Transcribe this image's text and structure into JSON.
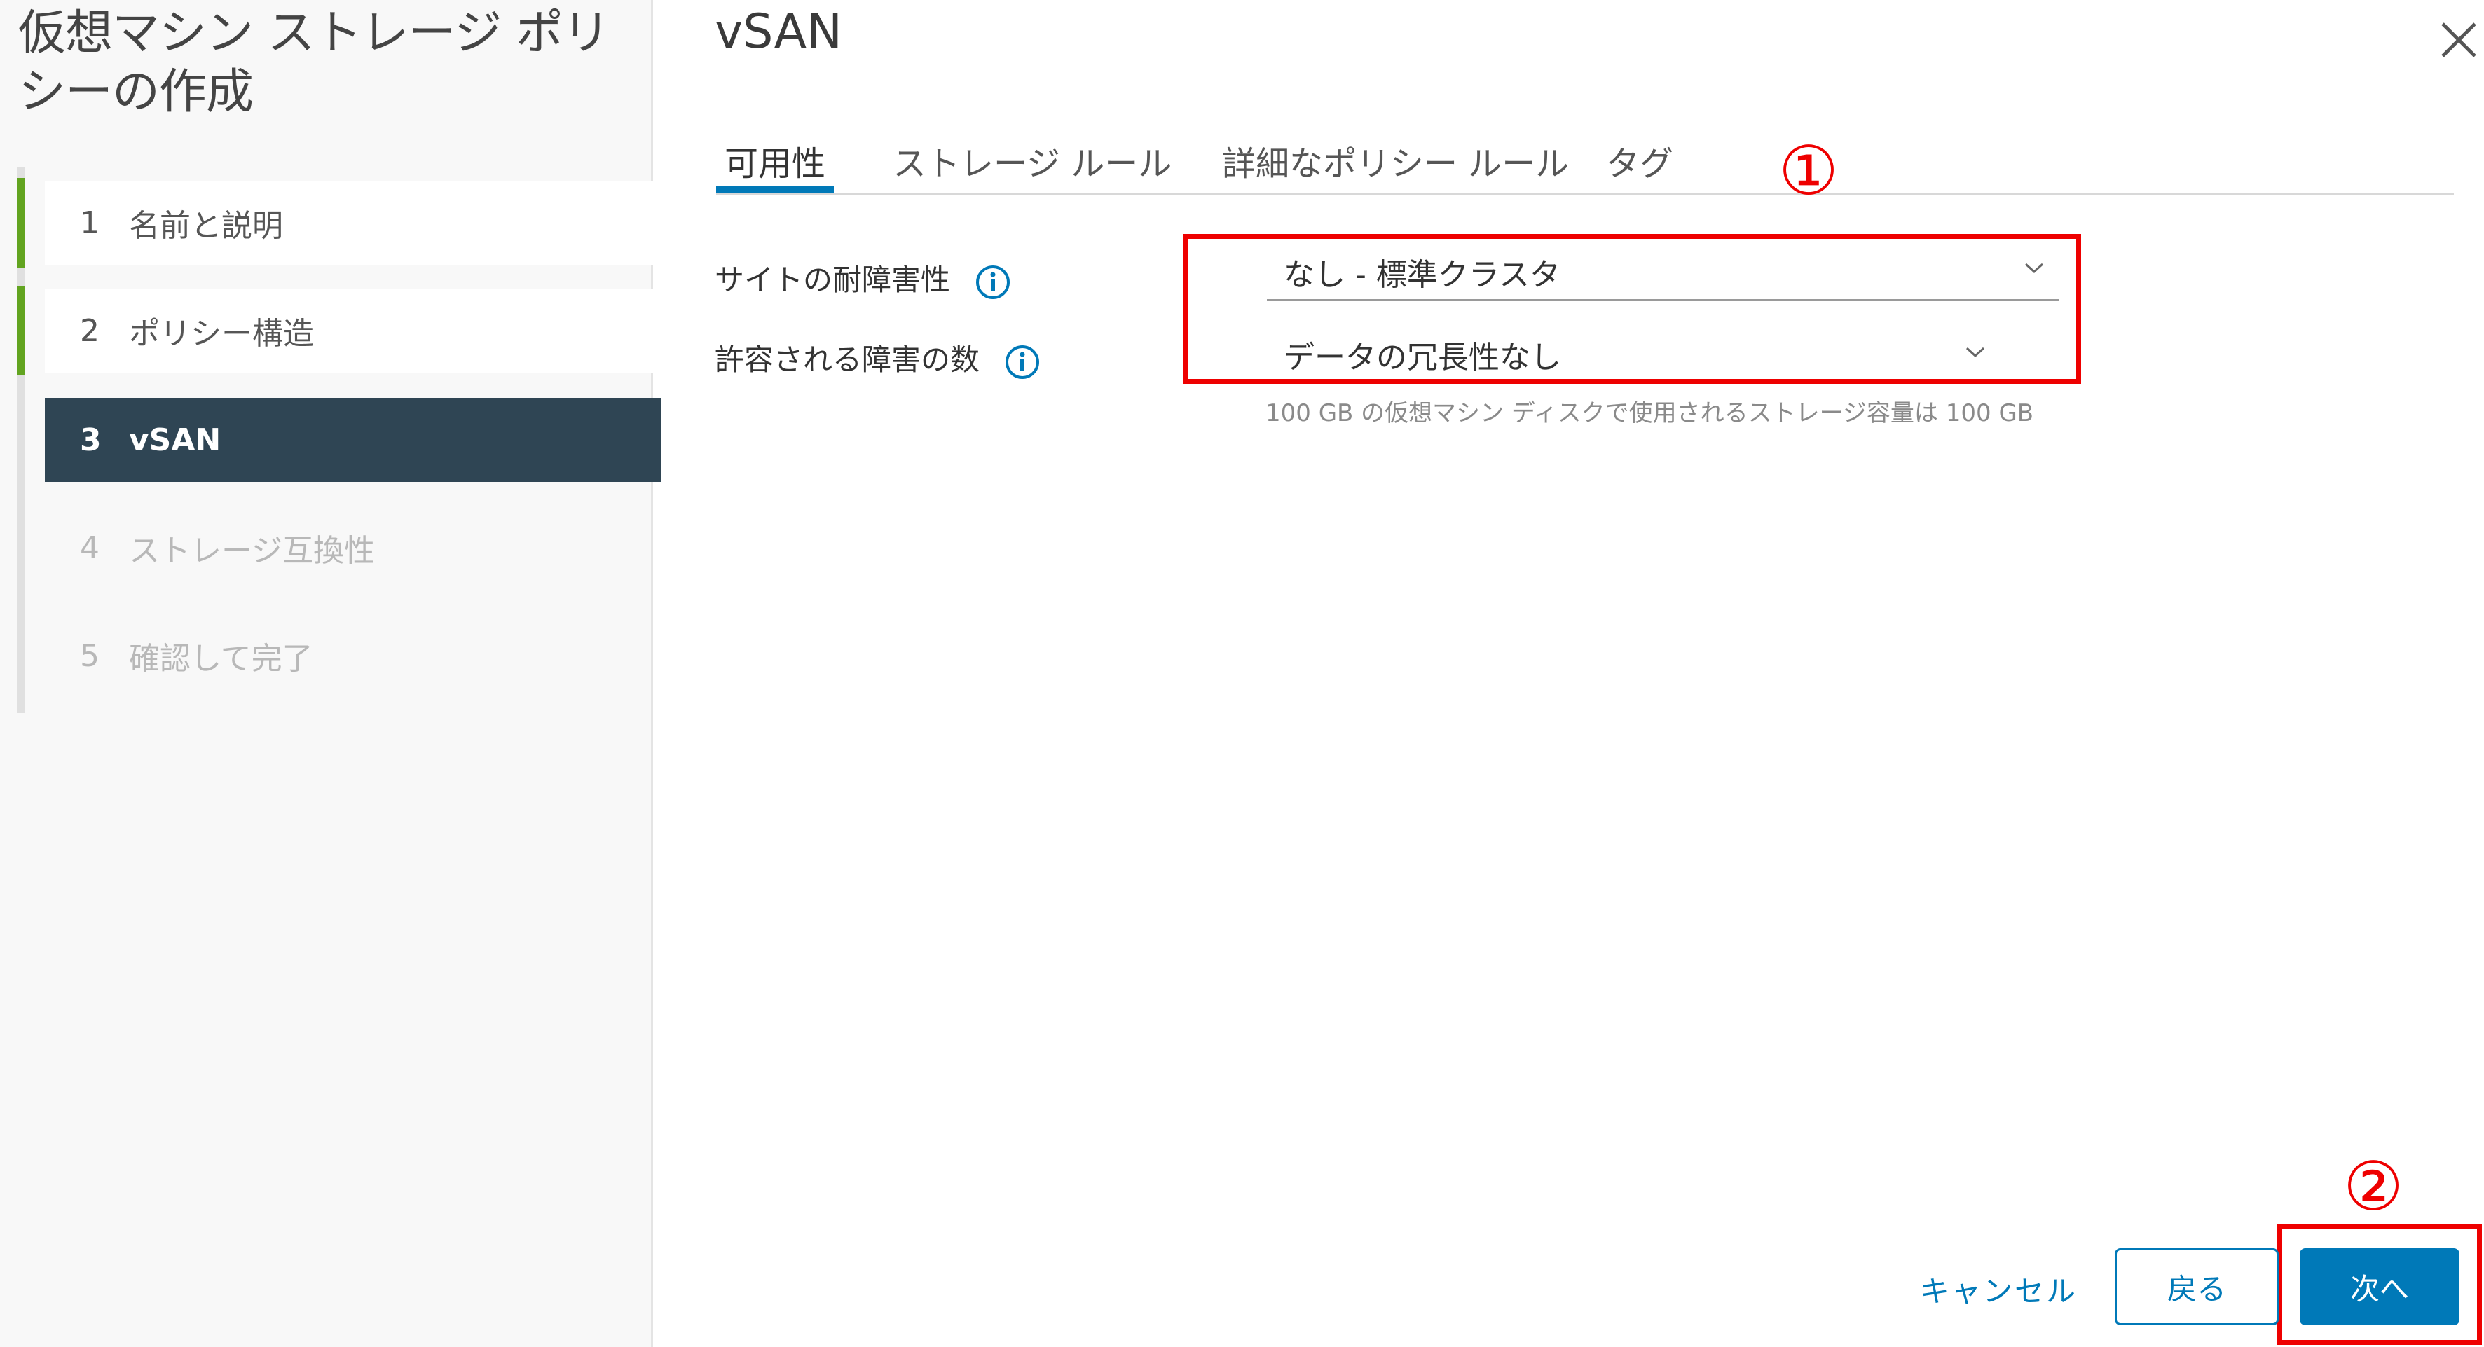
{
  "wizard": {
    "title": "仮想マシン ストレージ ポリシーの作成",
    "steps": [
      {
        "num": "1",
        "label": "名前と説明",
        "state": "done"
      },
      {
        "num": "2",
        "label": "ポリシー構造",
        "state": "done"
      },
      {
        "num": "3",
        "label": "vSAN",
        "state": "active"
      },
      {
        "num": "4",
        "label": "ストレージ互換性",
        "state": "disabled"
      },
      {
        "num": "5",
        "label": "確認して完了",
        "state": "disabled"
      }
    ]
  },
  "page": {
    "title": "vSAN",
    "tabs": [
      "可用性",
      "ストレージ ルール",
      "詳細なポリシー ルール",
      "タグ"
    ],
    "active_tab": "可用性"
  },
  "form": {
    "site_fault_tolerance": {
      "label": "サイトの耐障害性",
      "value": "なし - 標準クラスタ"
    },
    "failures_to_tolerate": {
      "label": "許容される障害の数",
      "value": "データの冗長性なし"
    },
    "hint": "100 GB の仮想マシン ディスクで使用されるストレージ容量は 100 GB"
  },
  "annotations": {
    "marker1": "①",
    "marker2": "②",
    "color": "#ee0000"
  },
  "footer": {
    "cancel": "キャンセル",
    "back": "戻る",
    "next": "次へ"
  },
  "colors": {
    "accent": "#0079b8",
    "active_step_bg": "#2f4554",
    "done_step_bar": "#62a420"
  },
  "icons": [
    "close-icon",
    "info-icon",
    "chevron-down-icon"
  ]
}
